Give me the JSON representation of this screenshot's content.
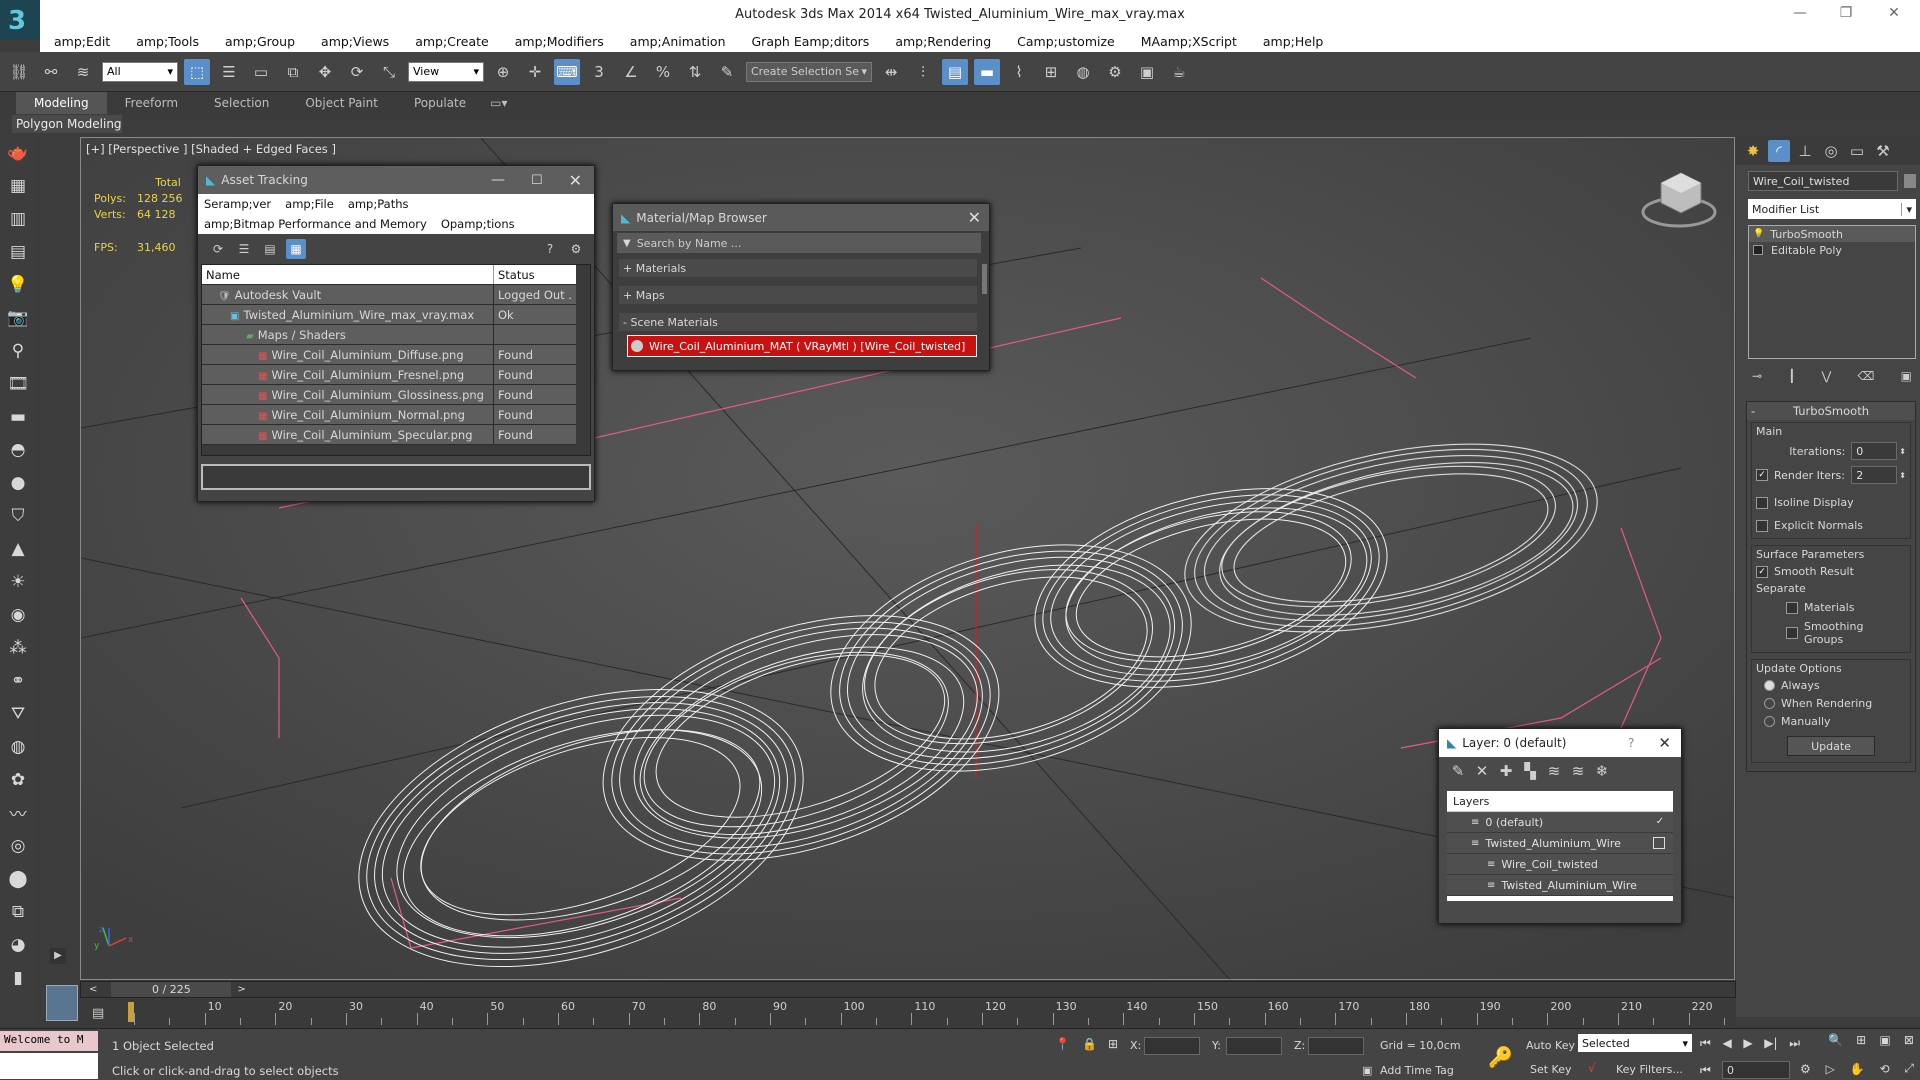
{
  "window": {
    "title": "Autodesk 3ds Max  2014 x64     Twisted_Aluminium_Wire_max_vray.max",
    "minimize": "—",
    "restore": "❐",
    "close": "✕"
  },
  "menu": [
    "amp;Edit",
    "amp;Tools",
    "amp;Group",
    "amp;Views",
    "amp;Create",
    "amp;Modifiers",
    "amp;Animation",
    "Graph Eamp;ditors",
    "amp;Rendering",
    "Camp;ustomize",
    "MAamp;XScript",
    "amp;Help"
  ],
  "toolbar": {
    "filter_select": "All",
    "view_select": "View",
    "selection_set_placeholder": "Create Selection Se"
  },
  "ribbon": {
    "tabs": [
      "Modeling",
      "Freeform",
      "Selection",
      "Object Paint",
      "Populate"
    ],
    "active_tab": "Modeling",
    "sub_label": "Polygon Modeling"
  },
  "viewport": {
    "label": "[+] [Perspective ] [Shaded + Edged Faces ]",
    "stats": {
      "total_label": "Total",
      "polys_label": "Polys:",
      "polys_value": "128 256",
      "verts_label": "Verts:",
      "verts_value": "64 128",
      "fps_label": "FPS:",
      "fps_value": "31,460"
    },
    "axis_labels": {
      "x": "x",
      "y": "y",
      "z": "z"
    }
  },
  "asset_tracking": {
    "title": "Asset Tracking",
    "menu": [
      "Seramp;ver",
      "amp;File",
      "amp;Paths",
      "amp;Bitmap Performance and Memory",
      "Opamp;tions"
    ],
    "col_name": "Name",
    "col_status": "Status",
    "rows": [
      {
        "name": "Autodesk Vault",
        "status": "Logged Out ."
      },
      {
        "name": "Twisted_Aluminium_Wire_max_vray.max",
        "status": "Ok"
      },
      {
        "name": "Maps / Shaders",
        "status": ""
      },
      {
        "name": "Wire_Coil_Aluminium_Diffuse.png",
        "status": "Found"
      },
      {
        "name": "Wire_Coil_Aluminium_Fresnel.png",
        "status": "Found"
      },
      {
        "name": "Wire_Coil_Aluminium_Glossiness.png",
        "status": "Found"
      },
      {
        "name": "Wire_Coil_Aluminium_Normal.png",
        "status": "Found"
      },
      {
        "name": "Wire_Coil_Aluminium_Specular.png",
        "status": "Found"
      }
    ]
  },
  "material_browser": {
    "title": "Material/Map Browser",
    "search_placeholder": "Search by Name ...",
    "sections": [
      "+ Materials",
      "+ Maps",
      "- Scene Materials"
    ],
    "scene_material": "Wire_Coil_Aluminium_MAT  ( VRayMtl )  [Wire_Coil_twisted]"
  },
  "layer_window": {
    "title": "Layer: 0 (default)",
    "help": "?",
    "header": "Layers",
    "rows": [
      {
        "name": "0 (default)",
        "check": "✓"
      },
      {
        "name": "Twisted_Aluminium_Wire",
        "check": ""
      },
      {
        "name": "Wire_Coil_twisted",
        "check": ""
      },
      {
        "name": "Twisted_Aluminium_Wire",
        "check": ""
      }
    ]
  },
  "command_panel": {
    "object_name": "Wire_Coil_twisted",
    "modifier_list": "Modifier List",
    "stack": [
      "TurboSmooth",
      "Editable Poly"
    ],
    "rollout_title": "TurboSmooth",
    "main_label": "Main",
    "iterations_label": "Iterations:",
    "iterations_value": "0",
    "render_iters_label": "Render Iters:",
    "render_iters_value": "2",
    "isoline_label": "Isoline Display",
    "explicit_label": "Explicit Normals",
    "surface_label": "Surface Parameters",
    "smooth_result_label": "Smooth Result",
    "separate_label": "Separate",
    "materials_label": "Materials",
    "smoothing_groups_label": "Smoothing Groups",
    "update_options_label": "Update Options",
    "always_label": "Always",
    "when_rendering_label": "When Rendering",
    "manually_label": "Manually",
    "update_button": "Update"
  },
  "timeline": {
    "frame_label": "0 / 225",
    "ticks": [
      "10",
      "20",
      "30",
      "40",
      "50",
      "60",
      "70",
      "80",
      "90",
      "100",
      "110",
      "120",
      "130",
      "140",
      "150",
      "160",
      "170",
      "180",
      "190",
      "200",
      "210",
      "220"
    ]
  },
  "status": {
    "maxscript": "Welcome to M",
    "selected": "1 Object Selected",
    "prompt": "Click or click-and-drag to select objects",
    "x_label": "X:",
    "y_label": "Y:",
    "z_label": "Z:",
    "grid": "Grid = 10,0cm",
    "add_time_tag": "Add Time Tag",
    "auto_key": "Auto Key",
    "set_key": "Set Key",
    "selected_dropdown": "Selected",
    "key_filters": "Key Filters...",
    "frame_value": "0"
  }
}
